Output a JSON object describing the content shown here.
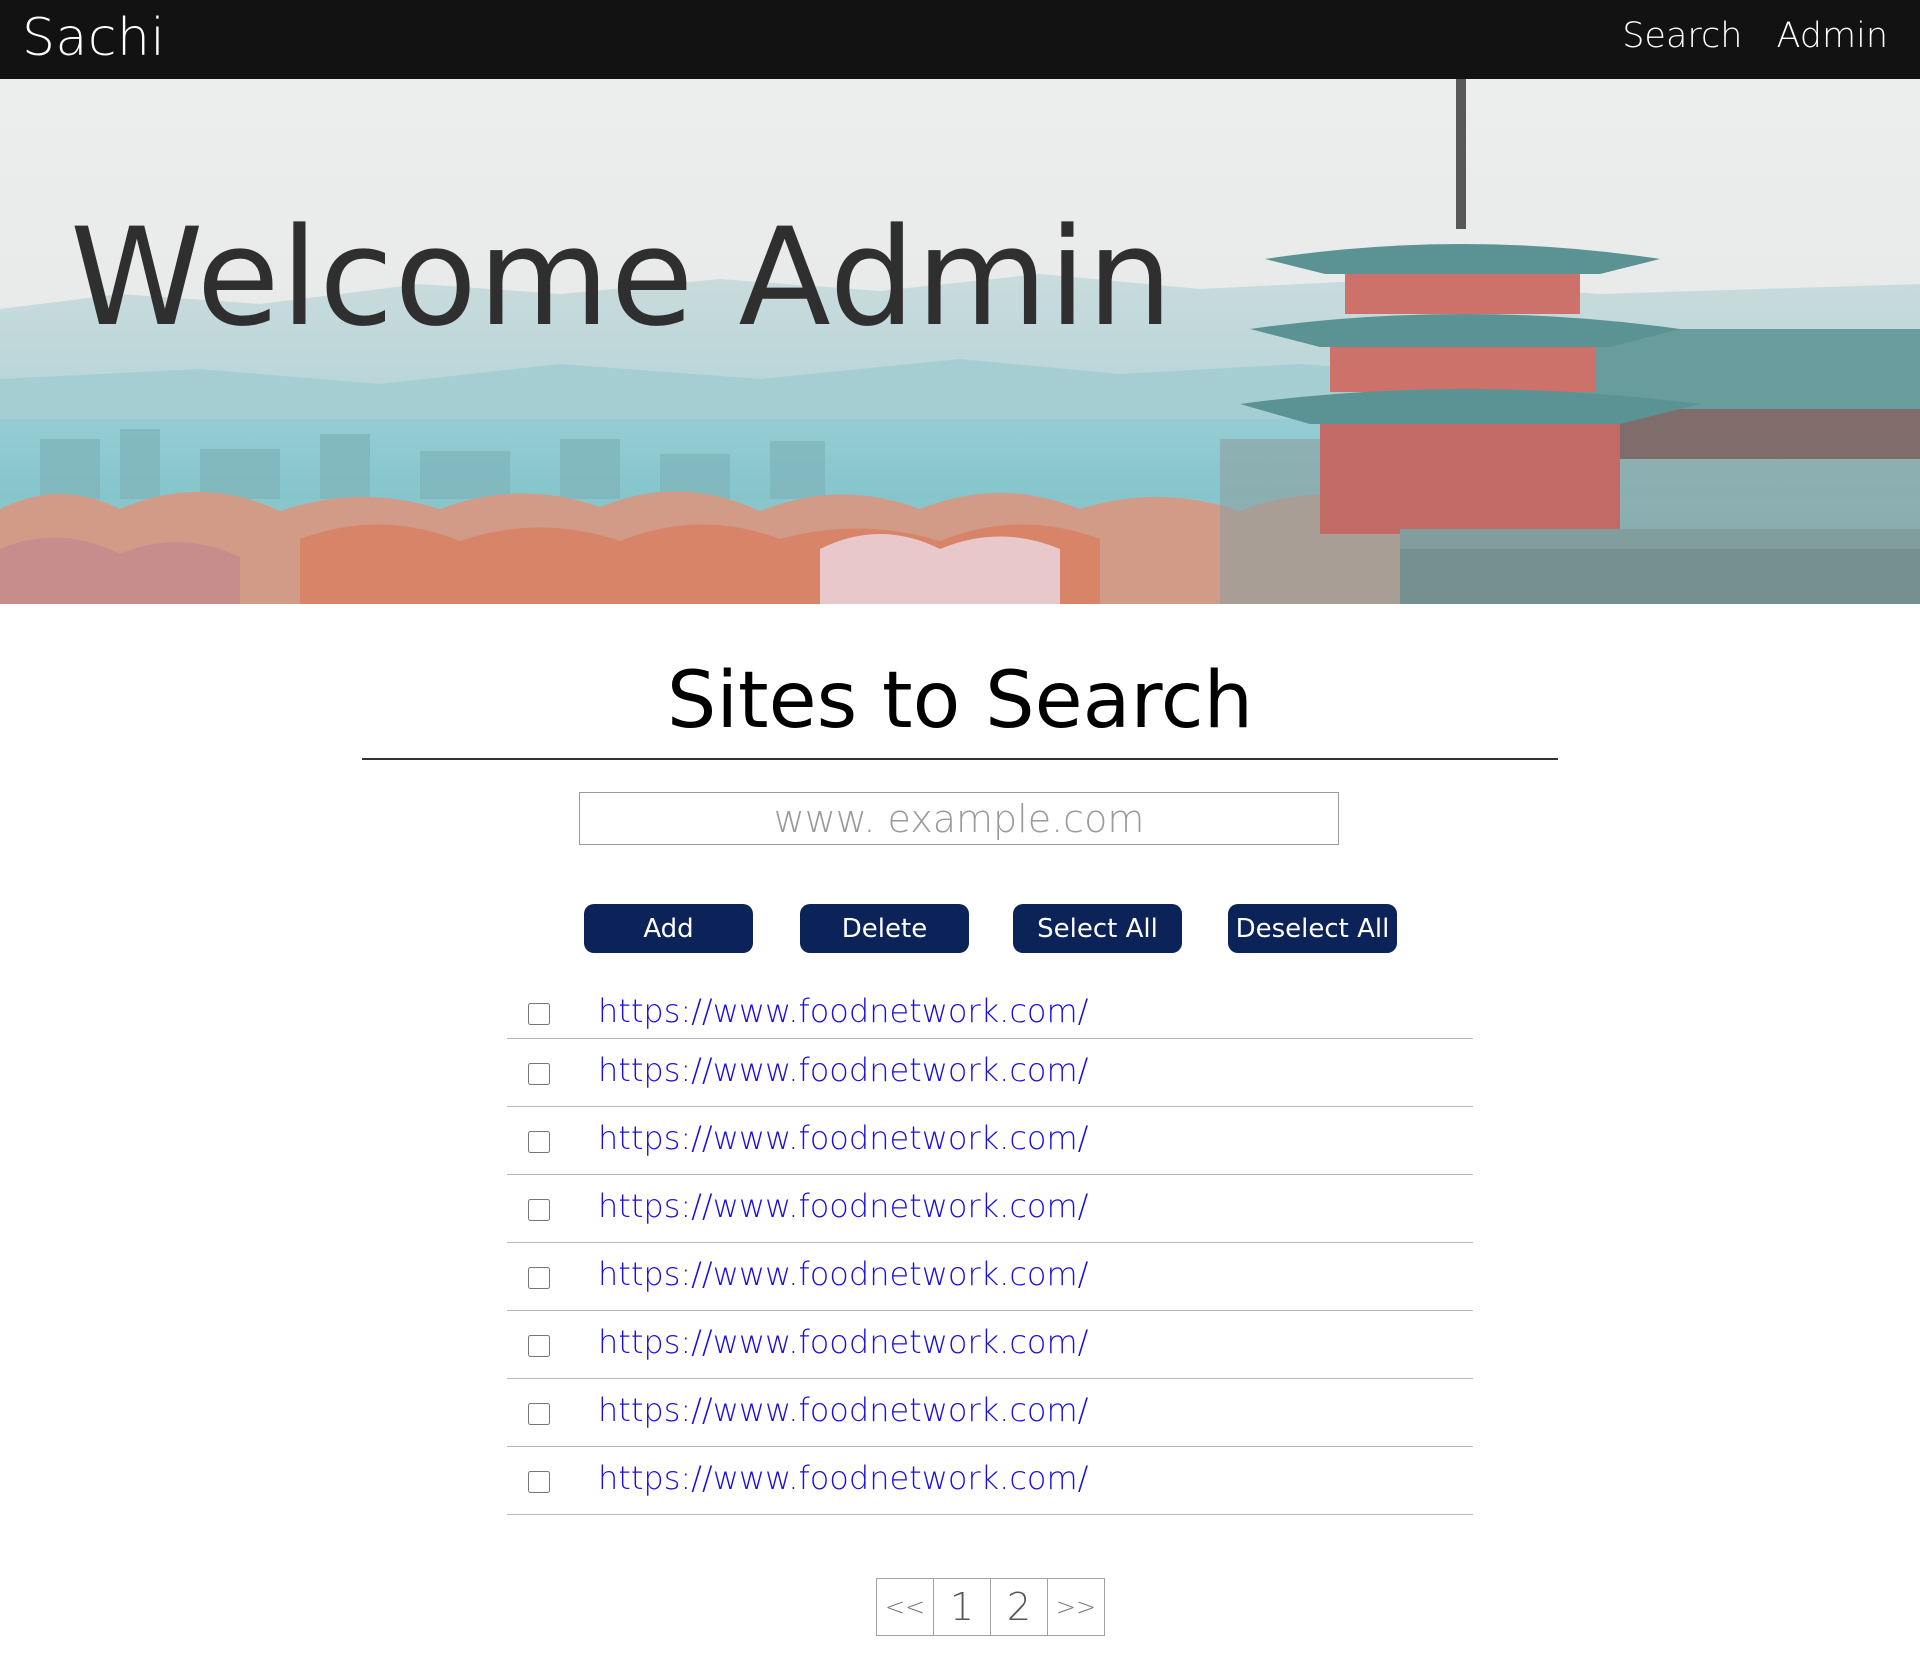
{
  "nav": {
    "brand": "Sachi",
    "links": [
      "Search",
      "Admin"
    ]
  },
  "hero": {
    "title": "Welcome Admin"
  },
  "section": {
    "title": "Sites to Search"
  },
  "site_input": {
    "placeholder": "www. example.com",
    "value": ""
  },
  "buttons": {
    "add": "Add",
    "delete": "Delete",
    "select_all": "Select All",
    "deselect_all": "Deselect All"
  },
  "sites": [
    {
      "url": "https://www.foodnetwork.com/",
      "checked": false
    },
    {
      "url": "https://www.foodnetwork.com/",
      "checked": false
    },
    {
      "url": "https://www.foodnetwork.com/",
      "checked": false
    },
    {
      "url": "https://www.foodnetwork.com/",
      "checked": false
    },
    {
      "url": "https://www.foodnetwork.com/",
      "checked": false
    },
    {
      "url": "https://www.foodnetwork.com/",
      "checked": false
    },
    {
      "url": "https://www.foodnetwork.com/",
      "checked": false
    },
    {
      "url": "https://www.foodnetwork.com/",
      "checked": false
    }
  ],
  "pagination": {
    "prev": "<<",
    "pages": [
      "1",
      "2"
    ],
    "next": ">>"
  },
  "colors": {
    "navbar": "#121212",
    "button": "#0b2358",
    "link": "#1a0ee0"
  }
}
